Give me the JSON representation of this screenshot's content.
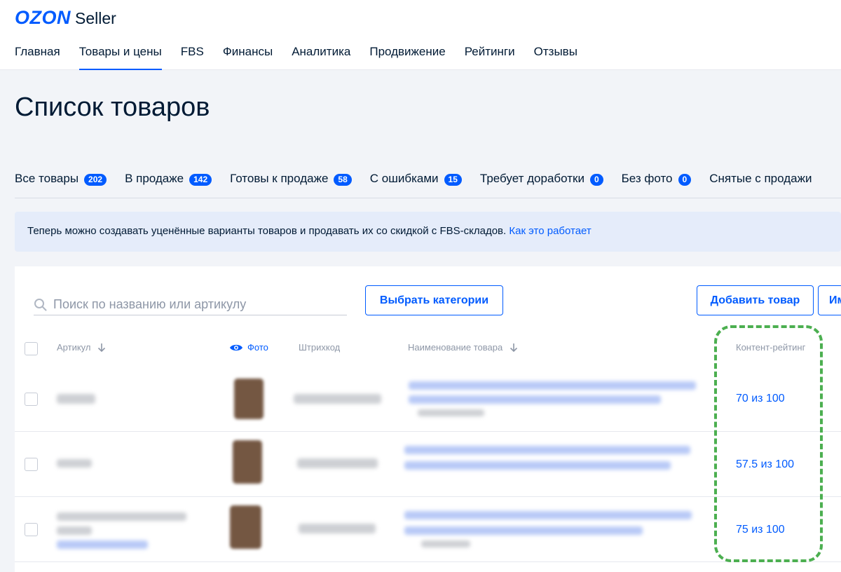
{
  "brand": {
    "logo_text": "OZON",
    "product": "Seller"
  },
  "main_nav": [
    {
      "label": "Главная"
    },
    {
      "label": "Товары и цены",
      "active": true
    },
    {
      "label": "FBS"
    },
    {
      "label": "Финансы"
    },
    {
      "label": "Аналитика"
    },
    {
      "label": "Продвижение"
    },
    {
      "label": "Рейтинги"
    },
    {
      "label": "Отзывы"
    }
  ],
  "page": {
    "title": "Список товаров"
  },
  "tabs": [
    {
      "label": "Все товары",
      "count": "202"
    },
    {
      "label": "В продаже",
      "count": "142",
      "active": true
    },
    {
      "label": "Готовы к продаже",
      "count": "58"
    },
    {
      "label": "С ошибками",
      "count": "15"
    },
    {
      "label": "Требует доработки",
      "count": "0"
    },
    {
      "label": "Без фото",
      "count": "0"
    },
    {
      "label": "Снятые с продажи",
      "count": ""
    }
  ],
  "notice": {
    "text": "Теперь можно создавать уценённые варианты товаров и продавать их со скидкой с FBS-складов.",
    "link": "Как это работает"
  },
  "toolbar": {
    "search_placeholder": "Поиск по названию или артикулу",
    "categories_button": "Выбрать категории",
    "add_button": "Добавить товар",
    "more_button": "Им"
  },
  "table": {
    "columns": {
      "article": "Артикул",
      "photo": "Фото",
      "barcode": "Штрихкод",
      "name": "Наименование товара",
      "rating": "Контент-рейтинг"
    },
    "rows": [
      {
        "rating": "70 из 100"
      },
      {
        "rating": "57.5 из 100"
      },
      {
        "rating": "75 из 100"
      }
    ]
  },
  "colors": {
    "accent": "#005bff",
    "highlight": "#4caf50",
    "background": "#f2f4f8"
  },
  "icons": {
    "search": "search-icon",
    "photo_toggle": "eye-icon",
    "sort": "arrow-down-icon"
  }
}
